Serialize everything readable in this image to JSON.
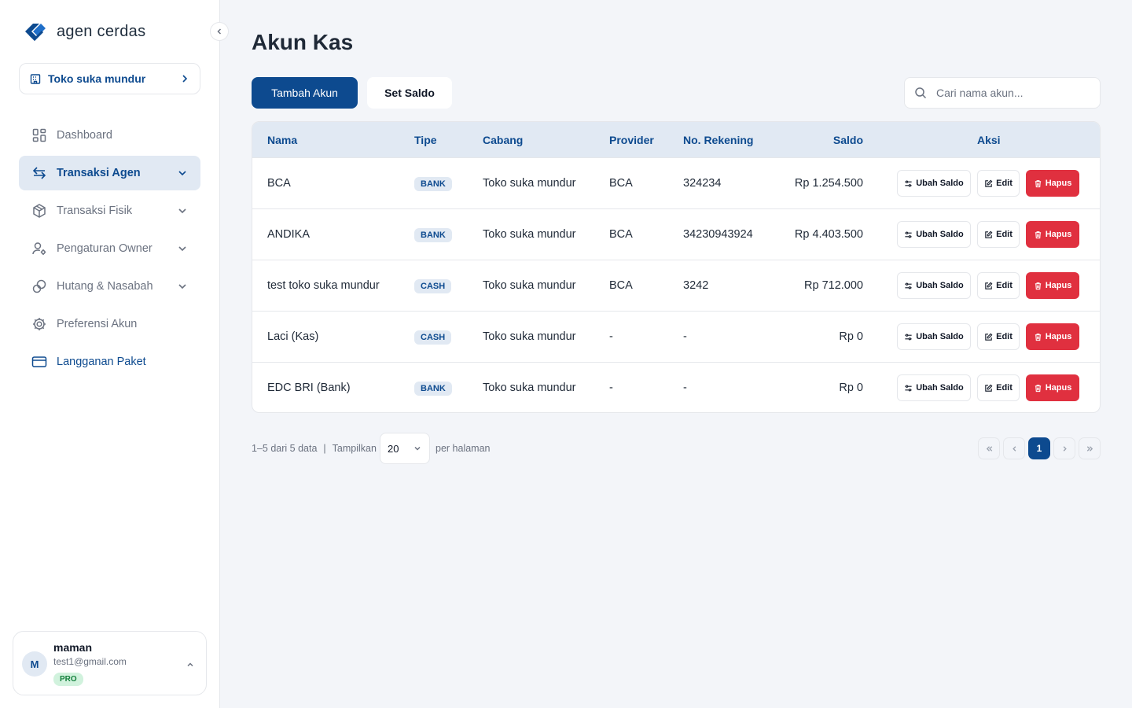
{
  "app": {
    "name": "agen cerdas"
  },
  "branch": {
    "label": "Toko suka mundur"
  },
  "nav": [
    {
      "label": "Dashboard",
      "icon": "dashboard-icon"
    },
    {
      "label": "Transaksi Agen",
      "icon": "transfer-icon"
    },
    {
      "label": "Transaksi Fisik",
      "icon": "box-icon"
    },
    {
      "label": "Pengaturan Owner",
      "icon": "user-settings-icon"
    },
    {
      "label": "Hutang & Nasabah",
      "icon": "coins-icon"
    },
    {
      "label": "Preferensi Akun",
      "icon": "gear-icon"
    },
    {
      "label": "Langganan Paket",
      "icon": "credit-card-icon"
    }
  ],
  "user": {
    "initial": "M",
    "name": "maman",
    "email": "test1@gmail.com",
    "plan": "PRO"
  },
  "page": {
    "title": "Akun Kas"
  },
  "toolbar": {
    "add_label": "Tambah Akun",
    "set_saldo_label": "Set Saldo",
    "search_placeholder": "Cari nama akun..."
  },
  "table": {
    "headers": {
      "nama": "Nama",
      "tipe": "Tipe",
      "cabang": "Cabang",
      "provider": "Provider",
      "rekening": "No. Rekening",
      "saldo": "Saldo",
      "aksi": "Aksi"
    },
    "actions": {
      "ubah": "Ubah Saldo",
      "edit": "Edit",
      "hapus": "Hapus"
    },
    "rows": [
      {
        "nama": "BCA",
        "tipe": "BANK",
        "cabang": "Toko suka mundur",
        "provider": "BCA",
        "rekening": "324234",
        "saldo": "Rp 1.254.500"
      },
      {
        "nama": "ANDIKA",
        "tipe": "BANK",
        "cabang": "Toko suka mundur",
        "provider": "BCA",
        "rekening": "34230943924",
        "saldo": "Rp 4.403.500"
      },
      {
        "nama": "test toko suka mundur",
        "tipe": "CASH",
        "cabang": "Toko suka mundur",
        "provider": "BCA",
        "rekening": "3242",
        "saldo": "Rp 712.000"
      },
      {
        "nama": "Laci (Kas)",
        "tipe": "CASH",
        "cabang": "Toko suka mundur",
        "provider": "-",
        "rekening": "-",
        "saldo": "Rp 0"
      },
      {
        "nama": "EDC BRI (Bank)",
        "tipe": "BANK",
        "cabang": "Toko suka mundur",
        "provider": "-",
        "rekening": "-",
        "saldo": "Rp 0"
      }
    ]
  },
  "pagination": {
    "range_text": "1–5 dari 5 data",
    "show_label": "Tampilkan",
    "page_size": "20",
    "per_page_label": "per halaman",
    "current_page": "1"
  },
  "colors": {
    "primary": "#0d4a8f",
    "danger": "#e0303f",
    "header_bg": "#e1e9f3",
    "page_bg": "#f3f5f9"
  }
}
